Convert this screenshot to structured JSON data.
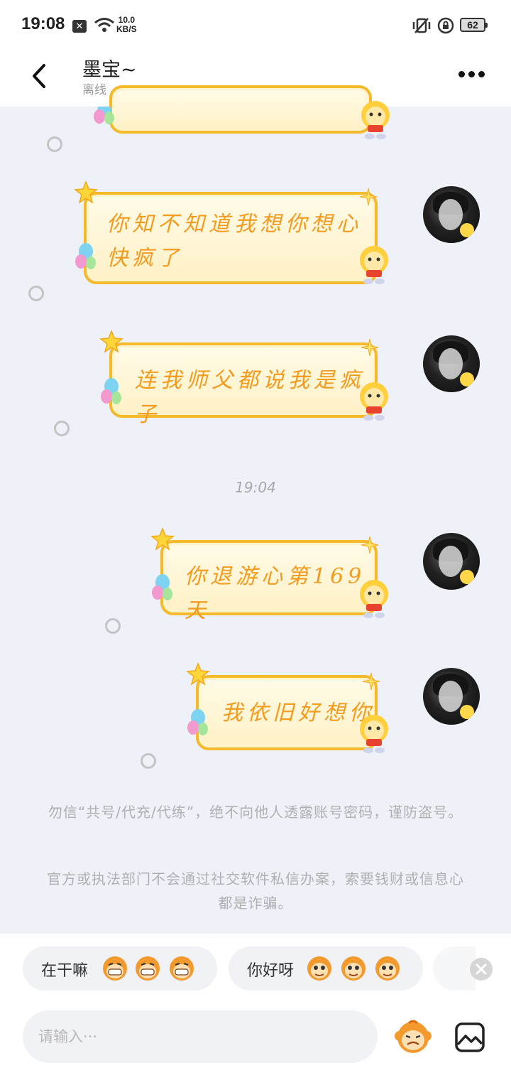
{
  "status_bar": {
    "time": "19:08",
    "x_badge": "✕",
    "net_speed_value": "10.0",
    "net_speed_unit": "KB/S",
    "battery": "62"
  },
  "header": {
    "title": "墨宝~",
    "subtitle": "离线"
  },
  "messages": [
    {
      "text": "你知不知道我想你想心快疯了"
    },
    {
      "text": "连我师父都说我是疯子"
    },
    {
      "text": "你退游心第169天"
    },
    {
      "text": "我依旧好想你"
    }
  ],
  "timestamp": "19:04",
  "notices": [
    "勿信“共号/代充/代练”，绝不向他人透露账号密码，谨防盗号。",
    "官方或执法部门不会通过社交软件私信办案，索要钱财或信息心都是诈骗。"
  ],
  "quick_replies": [
    {
      "label": "在干嘛"
    },
    {
      "label": "你好呀"
    }
  ],
  "input": {
    "placeholder": "请输入···"
  },
  "colors": {
    "bubble_border": "#f5b92c",
    "bubble_text": "#f39b1f",
    "background": "#eef1f7"
  },
  "icons": {
    "back": "chevron-left-icon",
    "more": "more-dots-icon",
    "sticker": "monkey-face-icon",
    "image": "image-icon",
    "close": "close-icon"
  }
}
